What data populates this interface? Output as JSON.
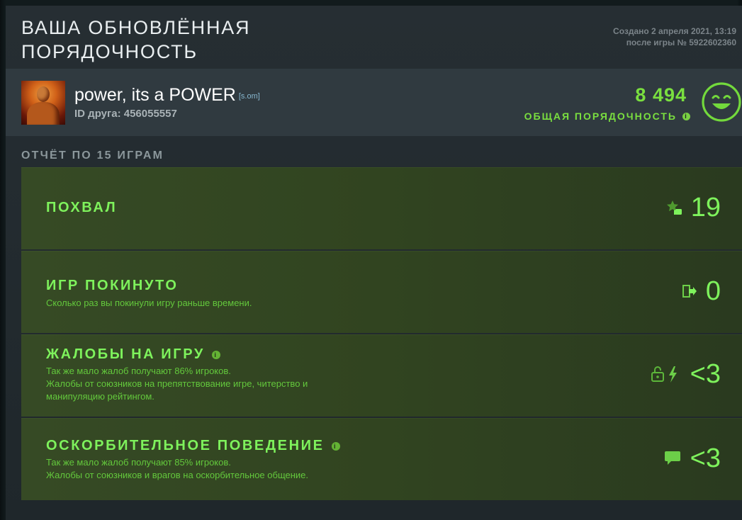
{
  "header": {
    "title": "ВАША ОБНОВЛЁННАЯ\nПОРЯДОЧНОСТЬ",
    "created_line1": "Создано 2 апреля 2021, 13:19",
    "created_line2": "после игры № 5922602360"
  },
  "player": {
    "name": "power, its a POWER",
    "clan_tag": "[s.om]",
    "friend_id": "ID друга: 456055557"
  },
  "behavior": {
    "score": "8 494",
    "label": "ОБЩАЯ ПОРЯДОЧНОСТЬ",
    "info_icon": "info-icon",
    "status_icon": "smiley-face-icon",
    "accent_color": "#7adf3f"
  },
  "report": {
    "title": "ОТЧЁТ ПО 15 ИГРАМ",
    "rows": [
      {
        "title": "ПОХВАЛ",
        "description": "",
        "icon": "star-thumb-icon",
        "value": "19"
      },
      {
        "title": "ИГР ПОКИНУТО",
        "description": "Сколько раз вы покинули игру раньше времени.",
        "icon": "exit-door-icon",
        "value": "0"
      },
      {
        "title": "ЖАЛОБЫ НА ИГРУ",
        "description": "Так же мало жалоб получают 86% игроков.\nЖалобы от союзников на препятствование игре, читерство и\nманипуляцию рейтингом.",
        "icon": "lock-lightning-icon",
        "value": "<3"
      },
      {
        "title": "ОСКОРБИТЕЛЬНОЕ ПОВЕДЕНИЕ",
        "description": "Так же мало жалоб получают 85% игроков.\nЖалобы от союзников и врагов на оскорбительное общение.",
        "icon": "chat-bubble-icon",
        "value": "<3"
      }
    ]
  }
}
